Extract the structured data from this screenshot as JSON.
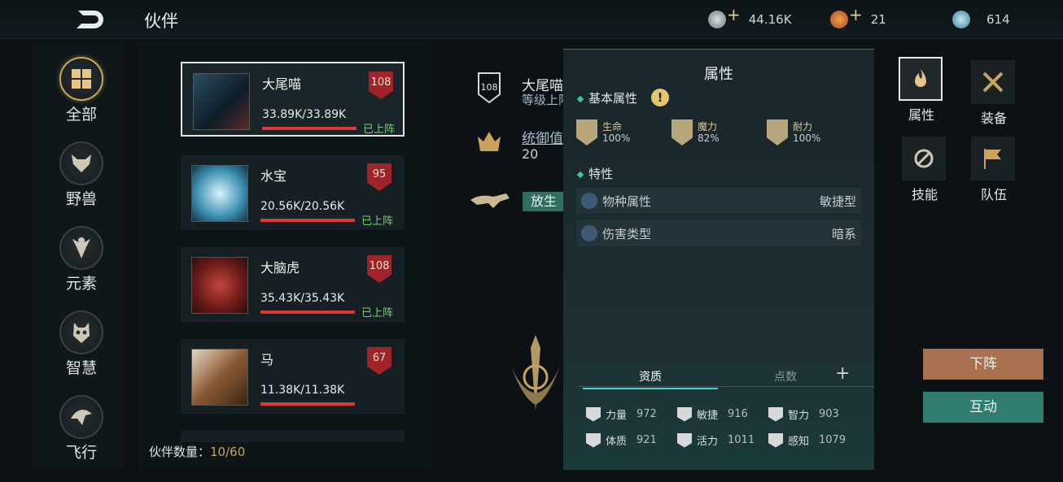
{
  "header": {
    "title": "伙伴",
    "currencies": [
      {
        "icon": "silver-coin-icon",
        "value": "44.16K",
        "has_plus": true,
        "color": "#9aa4a8"
      },
      {
        "icon": "gold-coin-icon",
        "value": "21",
        "has_plus": true,
        "color": "#d1763a"
      },
      {
        "icon": "crystal-icon",
        "value": "614",
        "has_plus": false,
        "color": "#6fb0c8"
      }
    ]
  },
  "categories": [
    {
      "label": "全部",
      "icon": "grid-icon",
      "active": true
    },
    {
      "label": "野兽",
      "icon": "wolf-head-icon",
      "active": false
    },
    {
      "label": "元素",
      "icon": "fairy-icon",
      "active": false
    },
    {
      "label": "智慧",
      "icon": "owl-icon",
      "active": false
    },
    {
      "label": "飞行",
      "icon": "eagle-icon",
      "active": false
    }
  ],
  "pets": [
    {
      "name": "大尾喵",
      "hp": "33.89K/33.89K",
      "level": "108",
      "status": "已上阵",
      "selected": true
    },
    {
      "name": "水宝",
      "hp": "20.56K/20.56K",
      "level": "95",
      "status": "已上阵",
      "selected": false
    },
    {
      "name": "大脑虎",
      "hp": "35.43K/35.43K",
      "level": "108",
      "status": "已上阵",
      "selected": false
    },
    {
      "name": "马",
      "hp": "11.38K/11.38K",
      "level": "67",
      "status": "",
      "selected": false
    }
  ],
  "pet_count": {
    "label": "伙伴数量：",
    "value": "10/60"
  },
  "detail": {
    "level": "108",
    "name": "大尾喵",
    "level_line": "等级上限",
    "command_label": "统御值",
    "command_value": "20",
    "release": "放生"
  },
  "attr_panel": {
    "title": "属性",
    "basic_label": "基本属性",
    "basic_stats": [
      {
        "name": "生命",
        "percent": "100%"
      },
      {
        "name": "魔力",
        "percent": "82%"
      },
      {
        "name": "耐力",
        "percent": "100%"
      }
    ],
    "traits_label": "特性",
    "traits": [
      {
        "key": "物种属性",
        "value": "敏捷型"
      },
      {
        "key": "伤害类型",
        "value": "暗系"
      }
    ],
    "tabs": {
      "aptitude": "资质",
      "points": "点数",
      "plus": "+"
    },
    "qualities": [
      {
        "name": "力量",
        "value": "972"
      },
      {
        "name": "敏捷",
        "value": "916"
      },
      {
        "name": "智力",
        "value": "903"
      },
      {
        "name": "体质",
        "value": "921"
      },
      {
        "name": "活力",
        "value": "1011"
      },
      {
        "name": "感知",
        "value": "1079"
      }
    ]
  },
  "right_tabs": [
    {
      "label": "属性",
      "icon": "flame-icon",
      "active": true
    },
    {
      "label": "装备",
      "icon": "crossed-swords-icon",
      "active": false
    },
    {
      "label": "技能",
      "icon": "skill-icon",
      "active": false
    },
    {
      "label": "队伍",
      "icon": "flag-icon",
      "active": false
    }
  ],
  "actions": {
    "unassign": "下阵",
    "interact": "互动"
  },
  "colors": {
    "accent_gold": "#c9a45a",
    "deployed_green": "#6fd36a",
    "hp_red": "#e0353b",
    "teal": "#3fc6a5"
  }
}
